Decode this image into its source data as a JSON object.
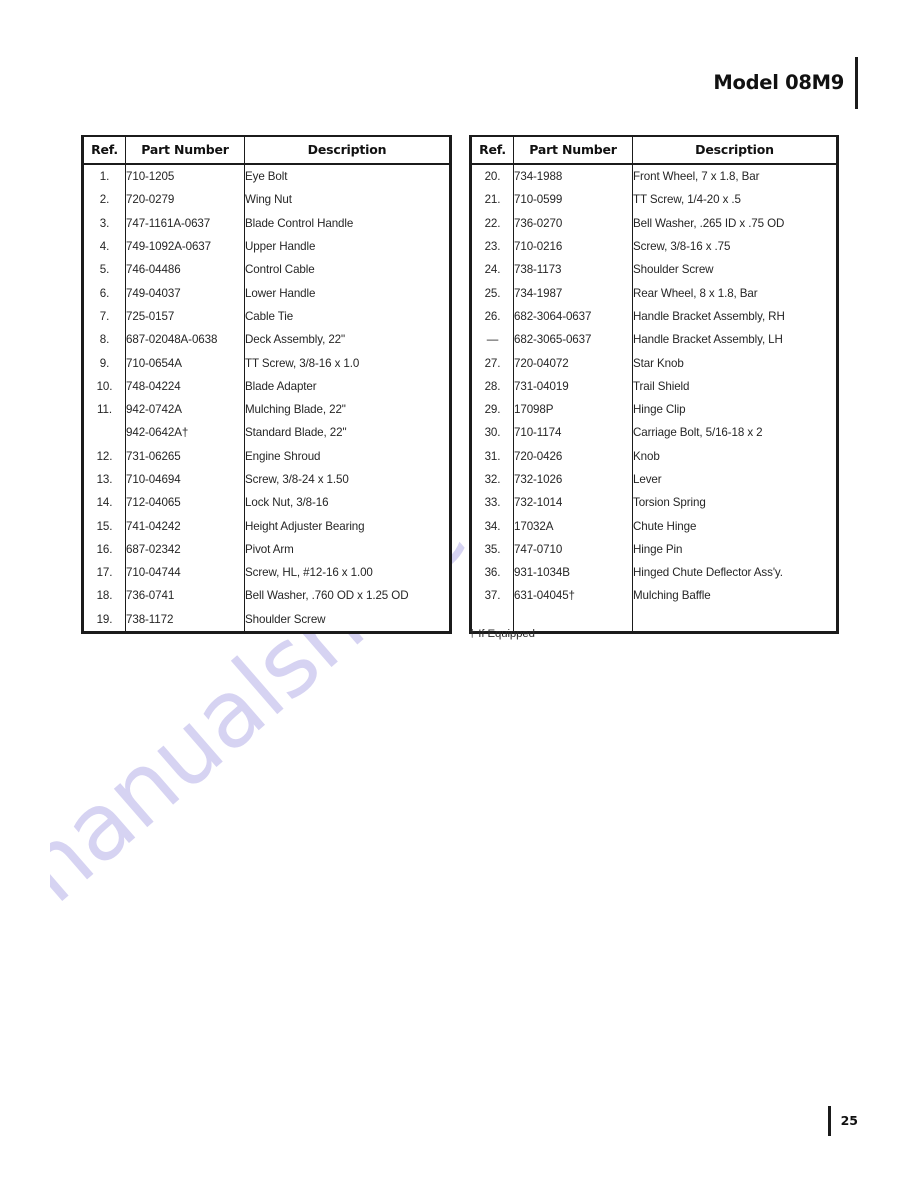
{
  "header": {
    "model_title": "Model 08M9"
  },
  "footer": {
    "page_number": "25"
  },
  "footnote": "† If Equipped",
  "tables": {
    "columns": {
      "ref": "Ref.",
      "part_number": "Part Number",
      "description": "Description"
    },
    "left": {
      "rows": [
        {
          "ref": "1.",
          "part": "710-1205",
          "desc": "Eye Bolt"
        },
        {
          "ref": "2.",
          "part": "720-0279",
          "desc": "Wing Nut"
        },
        {
          "ref": "3.",
          "part": "747-1161A-0637",
          "desc": "Blade Control Handle"
        },
        {
          "ref": "4.",
          "part": "749-1092A-0637",
          "desc": "Upper Handle"
        },
        {
          "ref": "5.",
          "part": "746-04486",
          "desc": "Control Cable"
        },
        {
          "ref": "6.",
          "part": "749-04037",
          "desc": "Lower Handle"
        },
        {
          "ref": "7.",
          "part": "725-0157",
          "desc": "Cable Tie"
        },
        {
          "ref": "8.",
          "part": "687-02048A-0638",
          "desc": "Deck Assembly, 22\""
        },
        {
          "ref": "9.",
          "part": "710-0654A",
          "desc": "TT Screw, 3/8-16 x 1.0"
        },
        {
          "ref": "10.",
          "part": "748-04224",
          "desc": "Blade Adapter"
        },
        {
          "ref": "11.",
          "part": "942-0742A",
          "desc": "Mulching Blade, 22\""
        },
        {
          "ref": "",
          "part": "942-0642A†",
          "desc": "Standard Blade, 22\""
        },
        {
          "ref": "12.",
          "part": "731-06265",
          "desc": "Engine Shroud"
        },
        {
          "ref": "13.",
          "part": "710-04694",
          "desc": "Screw, 3/8-24 x 1.50"
        },
        {
          "ref": "14.",
          "part": "712-04065",
          "desc": "Lock Nut, 3/8-16"
        },
        {
          "ref": "15.",
          "part": "741-04242",
          "desc": "Height Adjuster Bearing"
        },
        {
          "ref": "16.",
          "part": "687-02342",
          "desc": "Pivot Arm"
        },
        {
          "ref": "17.",
          "part": "710-04744",
          "desc": "Screw, HL, #12-16 x 1.00"
        },
        {
          "ref": "18.",
          "part": "736-0741",
          "desc": "Bell Washer, .760 OD x 1.25 OD"
        },
        {
          "ref": "19.",
          "part": "738-1172",
          "desc": "Shoulder Screw"
        }
      ]
    },
    "right": {
      "rows": [
        {
          "ref": "20.",
          "part": "734-1988",
          "desc": "Front Wheel, 7 x 1.8, Bar"
        },
        {
          "ref": "21.",
          "part": "710-0599",
          "desc": "TT Screw, 1/4-20 x .5"
        },
        {
          "ref": "22.",
          "part": "736-0270",
          "desc": "Bell Washer, .265 ID x .75 OD"
        },
        {
          "ref": "23.",
          "part": "710-0216",
          "desc": "Screw, 3/8-16 x .75"
        },
        {
          "ref": "24.",
          "part": "738-1173",
          "desc": "Shoulder Screw"
        },
        {
          "ref": "25.",
          "part": "734-1987",
          "desc": "Rear Wheel, 8 x 1.8, Bar"
        },
        {
          "ref": "26.",
          "part": "682-3064-0637",
          "desc": "Handle Bracket Assembly, RH"
        },
        {
          "ref": "—",
          "part": "682-3065-0637",
          "desc": "Handle Bracket Assembly, LH"
        },
        {
          "ref": "27.",
          "part": "720-04072",
          "desc": "Star Knob"
        },
        {
          "ref": "28.",
          "part": "731-04019",
          "desc": "Trail Shield"
        },
        {
          "ref": "29.",
          "part": "17098P",
          "desc": "Hinge Clip"
        },
        {
          "ref": "30.",
          "part": "710-1174",
          "desc": "Carriage Bolt, 5/16-18 x 2"
        },
        {
          "ref": "31.",
          "part": "720-0426",
          "desc": "Knob"
        },
        {
          "ref": "32.",
          "part": "732-1026",
          "desc": "Lever"
        },
        {
          "ref": "33.",
          "part": "732-1014",
          "desc": "Torsion Spring"
        },
        {
          "ref": "34.",
          "part": "17032A",
          "desc": "Chute Hinge"
        },
        {
          "ref": "35.",
          "part": "747-0710",
          "desc": "Hinge Pin"
        },
        {
          "ref": "36.",
          "part": "931-1034B",
          "desc": "Hinged Chute Deflector Ass'y."
        },
        {
          "ref": "37.",
          "part": "631-04045†",
          "desc": "Mulching Baffle"
        },
        {
          "ref": "",
          "part": "",
          "desc": ""
        }
      ]
    }
  },
  "watermark": {
    "text": "manualshive.com",
    "color": "#d6d3f2"
  }
}
